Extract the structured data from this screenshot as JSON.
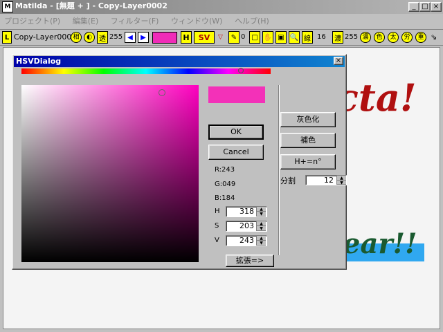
{
  "window": {
    "title": "Matilda - [無題 + ] - Copy-Layer0002",
    "icon": "app-logo-icon"
  },
  "menu": [
    "プロジェクト(P)",
    "編集(E)",
    "フィルター(F)",
    "ウィンドウ(W)",
    "ヘルプ(H)"
  ],
  "toolbar": {
    "layer_badge": "L",
    "layer_name": "Copy-Layer0002",
    "value_255": "255",
    "h_button": "H",
    "sv_button": "SV",
    "value_0": "0",
    "value_16": "16",
    "value_255b": "255",
    "fill_color": "#f02cb8",
    "icons": [
      "circle-1-icon",
      "circle-2-icon",
      "density-icon",
      "left-arrow-icon",
      "right-arrow-icon",
      "triangle-icon",
      "brush-icon",
      "rect-icon",
      "hand-icon",
      "bucket-icon",
      "zoom-icon",
      "line-icon",
      "density2-icon",
      "circle-3-icon",
      "circle-4-icon",
      "circle-5-icon",
      "circle-6-icon",
      "circle-7-icon"
    ]
  },
  "canvas": {
    "background_text_1": "cta!",
    "background_text_2": "ear!!"
  },
  "dialog": {
    "title": "HSVDialog",
    "color_hex": "#f331b8",
    "ok_label": "OK",
    "cancel_label": "Cancel",
    "r_text": "R:243",
    "g_text": "G:049",
    "b_text": "B:184",
    "h_label": "H",
    "h_value": "318",
    "s_label": "S",
    "s_value": "203",
    "v_label": "V",
    "v_value": "243",
    "expand_label": "拡張=>",
    "grayscale_label": "灰色化",
    "complement_label": "補色",
    "hue_n_label": "H+=n°",
    "divide_label": "分割",
    "divide_value": "12"
  }
}
